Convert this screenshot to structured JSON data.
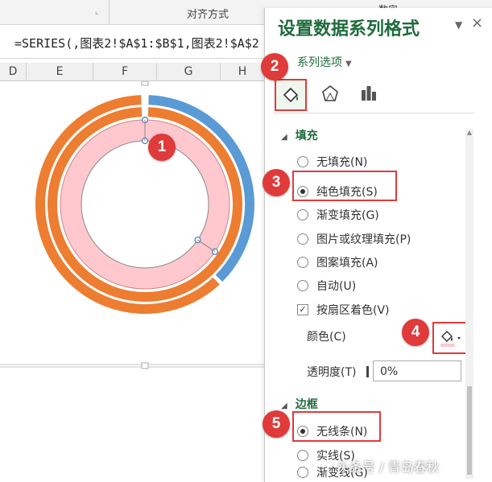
{
  "ribbon": {
    "group_align_label": "对齐方式",
    "group_number_label": "数字",
    "launcher_symbol": "⌞"
  },
  "formula_bar": {
    "text": "=SERIES(,图表2!$A$1:$B$1,图表2!$A$2"
  },
  "columns": [
    "D",
    "E",
    "F",
    "G",
    "H"
  ],
  "pane": {
    "title": "设置数据系列格式",
    "menu_symbol": "▼",
    "close_symbol": "×",
    "series_options_label": "系列选项",
    "fill_section": {
      "label": "填充",
      "options": [
        {
          "label": "无填充(N)",
          "checked": false
        },
        {
          "label": "纯色填充(S)",
          "checked": true
        },
        {
          "label": "渐变填充(G)",
          "checked": false
        },
        {
          "label": "图片或纹理填充(P)",
          "checked": false
        },
        {
          "label": "图案填充(A)",
          "checked": false
        },
        {
          "label": "自动(U)",
          "checked": false
        }
      ],
      "vary_colors_label": "按扇区着色(V)",
      "vary_colors_checked": true,
      "color_label": "颜色(C)",
      "transparency_label": "透明度(T)",
      "transparency_value": "0%"
    },
    "border_section": {
      "label": "边框",
      "options": [
        {
          "label": "无线条(N)",
          "checked": true
        },
        {
          "label": "实线(S)",
          "checked": false
        },
        {
          "label": "渐变线(G)",
          "checked": false
        }
      ]
    }
  },
  "badges": [
    "1",
    "2",
    "3",
    "4",
    "5"
  ],
  "watermark": "头条号 / 青岛春秋",
  "colors": {
    "accent_green": "#1e6b3c",
    "orange_ring": "#ed7d31",
    "blue_ring": "#5b9bd5",
    "pink_ring": "#ffc7ce",
    "highlight_red": "#e03a3a"
  },
  "icons": {
    "fill_tab": "paint-bucket-icon",
    "effects_tab": "pentagon-icon",
    "series_tab": "bar-chart-icon",
    "color_button": "paint-bucket-icon"
  }
}
